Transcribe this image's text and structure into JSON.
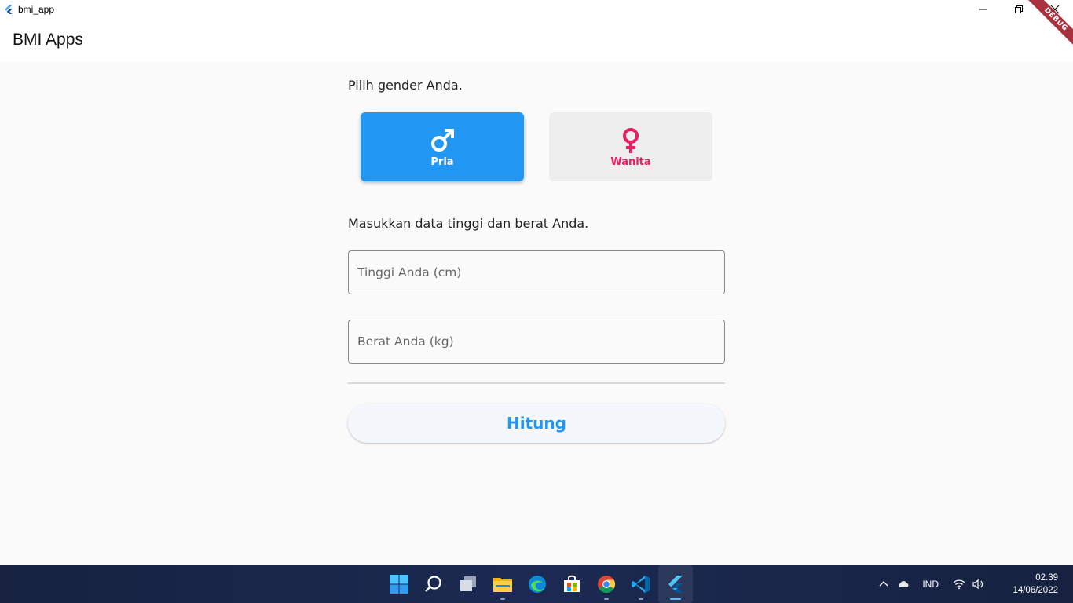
{
  "window": {
    "title": "bmi_app"
  },
  "appbar": {
    "title": "BMI Apps"
  },
  "debug_banner": {
    "label": "DEBUG",
    "color": "#a8323e"
  },
  "gender": {
    "prompt": "Pilih gender Anda.",
    "options": [
      {
        "label": "Pria",
        "icon": "male-icon",
        "selected": true,
        "color": "#2196f3"
      },
      {
        "label": "Wanita",
        "icon": "female-icon",
        "selected": false,
        "color": "#e91e63"
      }
    ]
  },
  "measurements": {
    "prompt": "Masukkan data tinggi dan berat Anda.",
    "height_placeholder": "Tinggi Anda (cm)",
    "weight_placeholder": "Berat Anda (kg)",
    "height_value": "",
    "weight_value": ""
  },
  "actions": {
    "calculate_label": "Hitung"
  },
  "taskbar": {
    "apps": [
      "start-icon",
      "search-icon",
      "task-view-icon",
      "file-explorer-icon",
      "edge-icon",
      "store-icon",
      "chrome-icon",
      "vscode-icon",
      "flutter-icon"
    ],
    "language": "IND",
    "time": "02.39",
    "date": "14/06/2022"
  }
}
